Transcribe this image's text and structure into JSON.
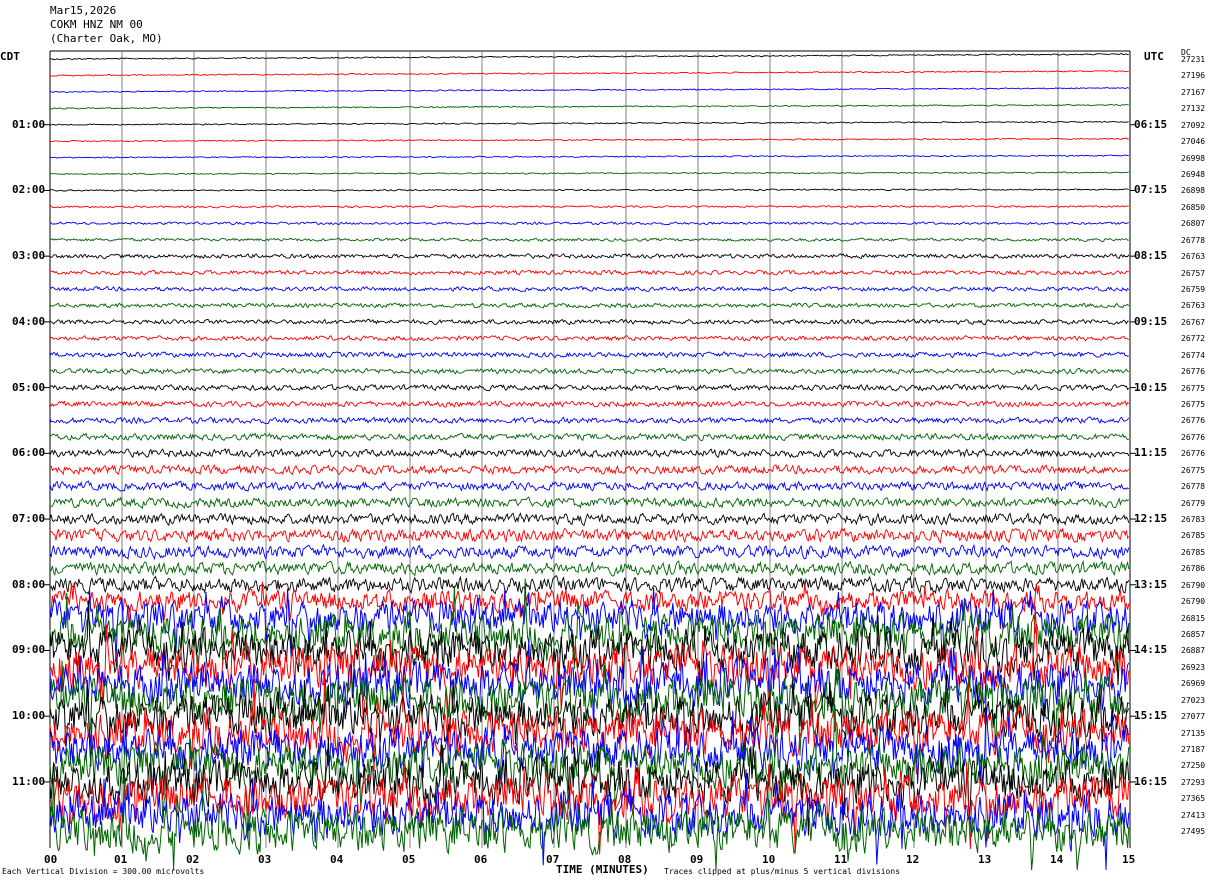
{
  "header": {
    "date": "Mar15,2026",
    "station": "COKM HNZ NM 00",
    "location": "(Charter Oak, MO)"
  },
  "left_timezone": "CDT",
  "right_timezone": "UTC",
  "dc_label": "DC",
  "footer": {
    "scale_note": "Each Vertical Division = 300.00 microvolts",
    "x_title": "TIME (MINUTES)",
    "clip_note": "Traces clipped at plus/minus 5 vertical divisions"
  },
  "colors": {
    "cycle": [
      "#000000",
      "#ff0000",
      "#0000ff",
      "#006400"
    ],
    "grid": "#808080"
  },
  "chart_data": {
    "type": "line",
    "x_ticks": [
      "00",
      "01",
      "02",
      "03",
      "04",
      "05",
      "06",
      "07",
      "08",
      "09",
      "10",
      "11",
      "12",
      "13",
      "14",
      "15"
    ],
    "xlim": [
      0,
      15
    ],
    "left_hour_labels": [
      "01:00",
      "02:00",
      "03:00",
      "04:00",
      "05:00",
      "06:00",
      "07:00",
      "08:00",
      "09:00",
      "10:00",
      "11:00"
    ],
    "right_hour_labels": [
      "06:15",
      "07:15",
      "08:15",
      "09:15",
      "10:15",
      "11:15",
      "12:15",
      "13:15",
      "14:15",
      "15:15",
      "16:15"
    ],
    "dc_offsets": [
      "27231",
      "27196",
      "27167",
      "27132",
      "27092",
      "27046",
      "26998",
      "26948",
      "26898",
      "26850",
      "26807",
      "26778",
      "26763",
      "26757",
      "26759",
      "26763",
      "26767",
      "26772",
      "26774",
      "26776",
      "26775",
      "26775",
      "26776",
      "26776",
      "26776",
      "26775",
      "26778",
      "26779",
      "26783",
      "26785",
      "26785",
      "26786",
      "26790",
      "26790",
      "26815",
      "26857",
      "26887",
      "26923",
      "26969",
      "27023",
      "27077",
      "27135",
      "27187",
      "27250",
      "27293",
      "27365",
      "27413",
      "27495"
    ],
    "trace_count": 48,
    "minutes_per_trace": 15,
    "relative_noise_amplitude": [
      0.3,
      0.3,
      0.3,
      0.3,
      0.3,
      0.3,
      0.3,
      0.3,
      0.35,
      0.45,
      0.6,
      0.7,
      1.0,
      1.0,
      1.0,
      1.0,
      1.1,
      1.1,
      1.2,
      1.2,
      1.3,
      1.3,
      1.4,
      1.5,
      1.8,
      2.0,
      2.0,
      2.2,
      2.5,
      3.0,
      3.0,
      3.0,
      3.5,
      5,
      8,
      9,
      10,
      10,
      10,
      10,
      10,
      10,
      10,
      10,
      10,
      10,
      10,
      10
    ]
  }
}
